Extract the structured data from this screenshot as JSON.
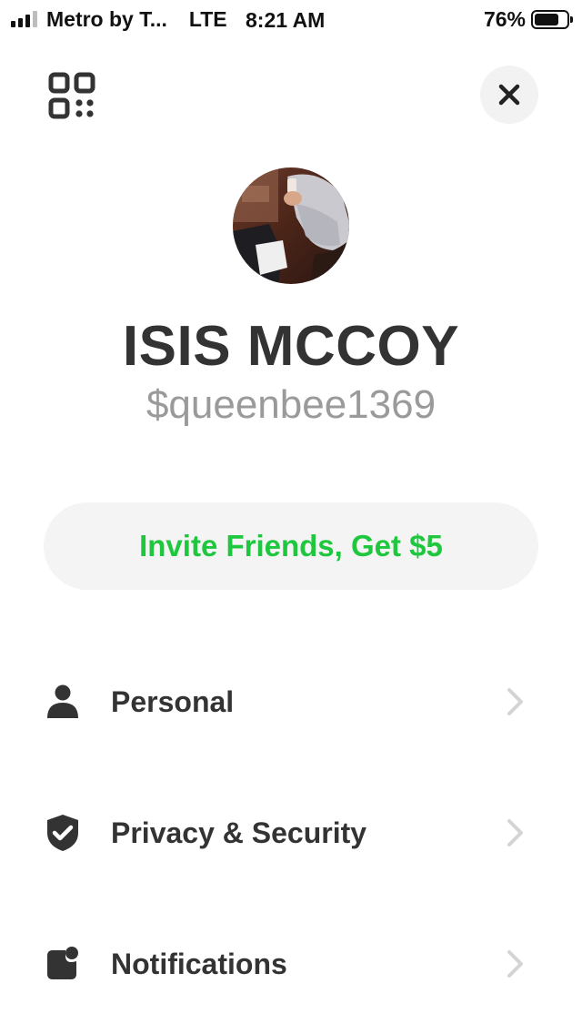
{
  "status_bar": {
    "carrier": "Metro by T...",
    "network": "LTE",
    "time": "8:21 AM",
    "battery_percent": "76%",
    "battery_level": 0.76
  },
  "icons": {
    "qr": "qr-code-icon",
    "close": "close-icon",
    "personal": "person-icon",
    "privacy": "shield-check-icon",
    "notifications": "notification-badge-icon",
    "chevron": "chevron-right-icon"
  },
  "profile": {
    "name": "ISIS MCCOY",
    "cashtag": "$queenbee1369"
  },
  "invite": {
    "label": "Invite Friends, Get $5"
  },
  "menu": [
    {
      "label": "Personal"
    },
    {
      "label": "Privacy & Security"
    },
    {
      "label": "Notifications"
    }
  ],
  "colors": {
    "accent_green": "#1fc73e",
    "text_dark": "#333333",
    "text_muted": "#9a9a9a",
    "pill_bg": "#f4f4f4",
    "chevron": "#d4d4d4"
  }
}
